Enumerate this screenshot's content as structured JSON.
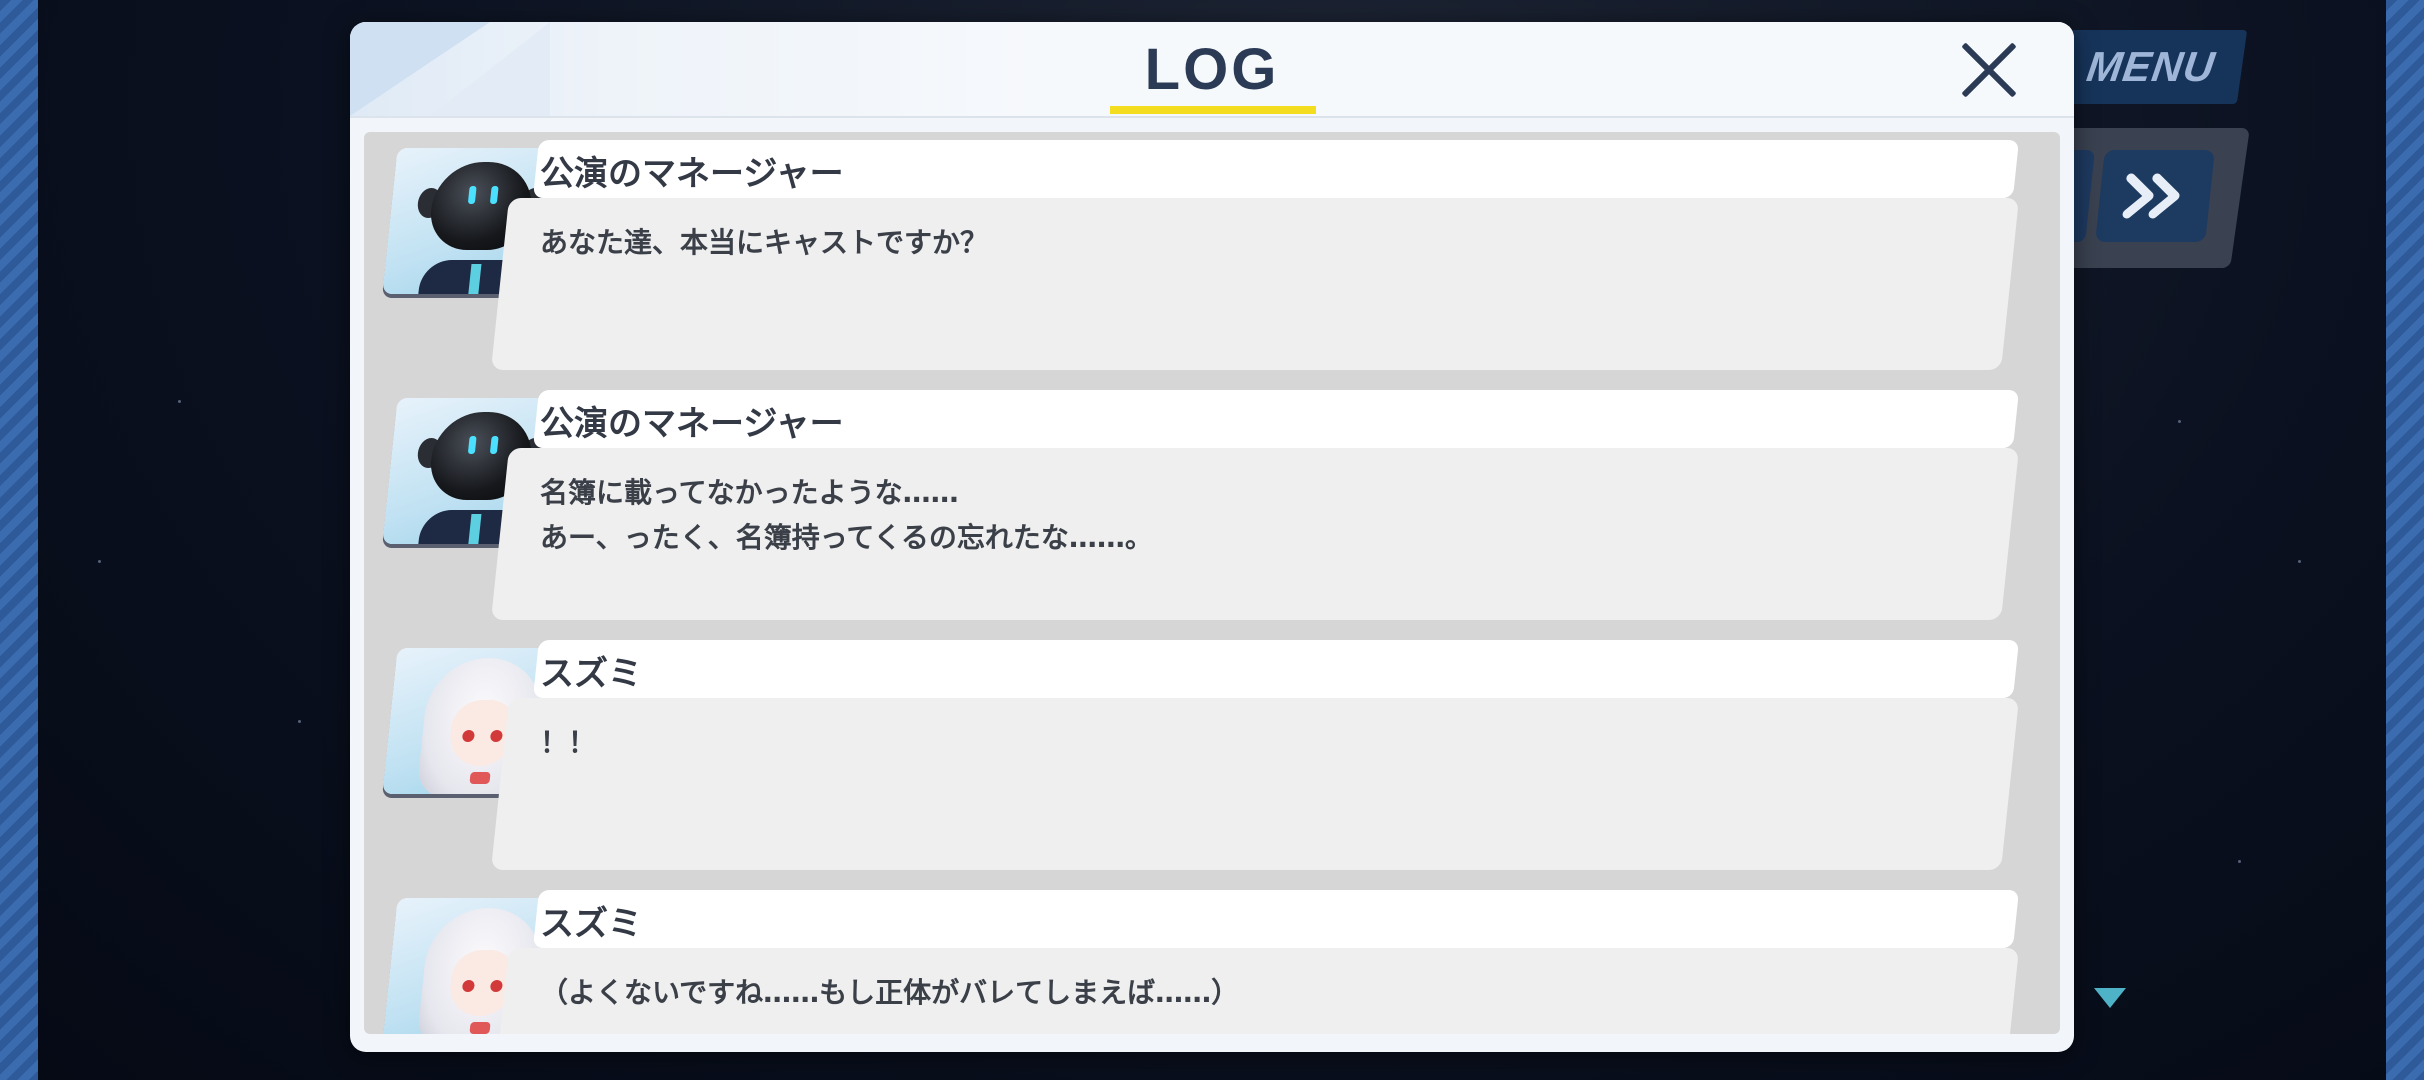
{
  "header": {
    "title": "LOG"
  },
  "menu": {
    "label": "MENU"
  },
  "colors": {
    "accent_underline": "#f3dd1e",
    "panel": "#f2f5f9",
    "text": "#333945"
  },
  "entries": [
    {
      "speaker": "公演のマネージャー",
      "portrait": "robot-manager",
      "lines": [
        "あなた達、本当にキャストですか？"
      ]
    },
    {
      "speaker": "公演のマネージャー",
      "portrait": "robot-manager",
      "lines": [
        "名簿に載ってなかったような……",
        "あー、ったく、名簿持ってくるの忘れたな……。"
      ]
    },
    {
      "speaker": "スズミ",
      "portrait": "suzumi",
      "lines": [
        "！！"
      ]
    },
    {
      "speaker": "スズミ",
      "portrait": "suzumi",
      "lines": [
        "（よくないですね……もし正体がバレてしまえば……）"
      ]
    }
  ],
  "icons": {
    "close": "close-icon",
    "skip": "fast-forward-icon",
    "scroll": "scroll-down-arrow-icon"
  }
}
